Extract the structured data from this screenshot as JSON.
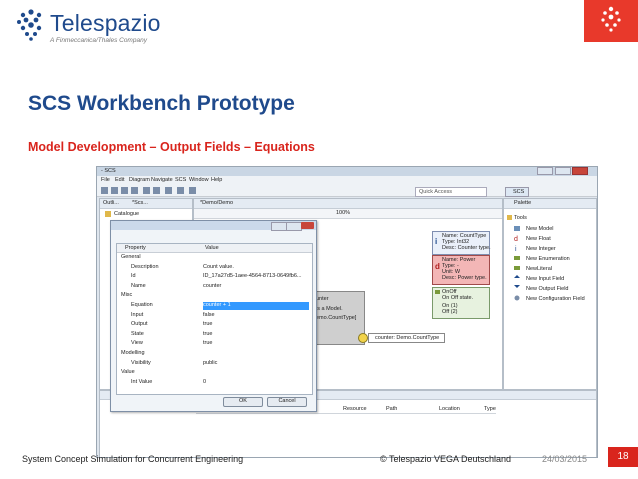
{
  "logo": {
    "name": "Telespazio",
    "tagline": "A Finmeccanica/Thales Company"
  },
  "slide": {
    "title": "SCS Workbench Prototype",
    "subtitle": "Model Development – Output Fields – Equations",
    "footer_left": "System Concept Simulation for Concurrent Engineering",
    "footer_copyright": "© Telespazio VEGA Deutschland",
    "footer_date": "24/03/2015",
    "page_number": "18"
  },
  "app": {
    "window_title": "- SCS",
    "menu": [
      "File",
      "Edit",
      "Diagram",
      "Navigate",
      "SCS",
      "Window",
      "Help"
    ],
    "quick_access": "Quick Access",
    "perspective": "SCS",
    "outline_tab": "Outli...",
    "scs_tab": "*Scs...",
    "editor_tab": "*Demo/Demo",
    "zoom": "100%",
    "tree_root": "Catalogue",
    "palette_title": "Palette",
    "palette_group": "Tools",
    "palette_items": [
      "New Model",
      "New Float",
      "New Integer",
      "New Enumeration",
      "NewLiteral",
      "New Input Field",
      "New Output Field",
      "New Configuration Field"
    ],
    "diagram": {
      "counttype": [
        "Name: CountType",
        "Type: Int32",
        "Desc: Counter type."
      ],
      "power": [
        "Name: Power",
        "Type: -",
        "Unit: W",
        "Desc: Power type."
      ],
      "onoff": [
        "OnOff",
        "On Off state."
      ],
      "onoff_items": [
        "On (1)",
        "Off (2)"
      ],
      "model_fragments": [
        "unter",
        "is a Model.",
        "emo.CountType]"
      ],
      "counter_port": "counter: Demo.CountType"
    },
    "bottom_columns": [
      "Resource",
      "Path",
      "Location",
      "Type"
    ]
  },
  "dialog": {
    "columns": [
      "Property",
      "Value"
    ],
    "rows": [
      {
        "name": "General",
        "value": "",
        "group": true
      },
      {
        "name": "Description",
        "value": "Count value."
      },
      {
        "name": "Id",
        "value": "ID_17a27d5-1aee-4564-8713-0649fb6..."
      },
      {
        "name": "Name",
        "value": "counter"
      },
      {
        "name": "Misc",
        "value": "",
        "group": true
      },
      {
        "name": "Equation",
        "value": "counter + 1",
        "selected": true
      },
      {
        "name": "Input",
        "value": "false"
      },
      {
        "name": "Output",
        "value": "true"
      },
      {
        "name": "State",
        "value": "true"
      },
      {
        "name": "View",
        "value": "true"
      },
      {
        "name": "Modelling",
        "value": "",
        "group": true
      },
      {
        "name": "Visibility",
        "value": "public"
      },
      {
        "name": "Value",
        "value": "",
        "group": true
      },
      {
        "name": "Int Value",
        "value": "0"
      }
    ],
    "ok_label": "OK",
    "cancel_label": "Cancel"
  },
  "colors": {
    "brand_blue": "#1f4a8c",
    "brand_red": "#d9251d"
  }
}
